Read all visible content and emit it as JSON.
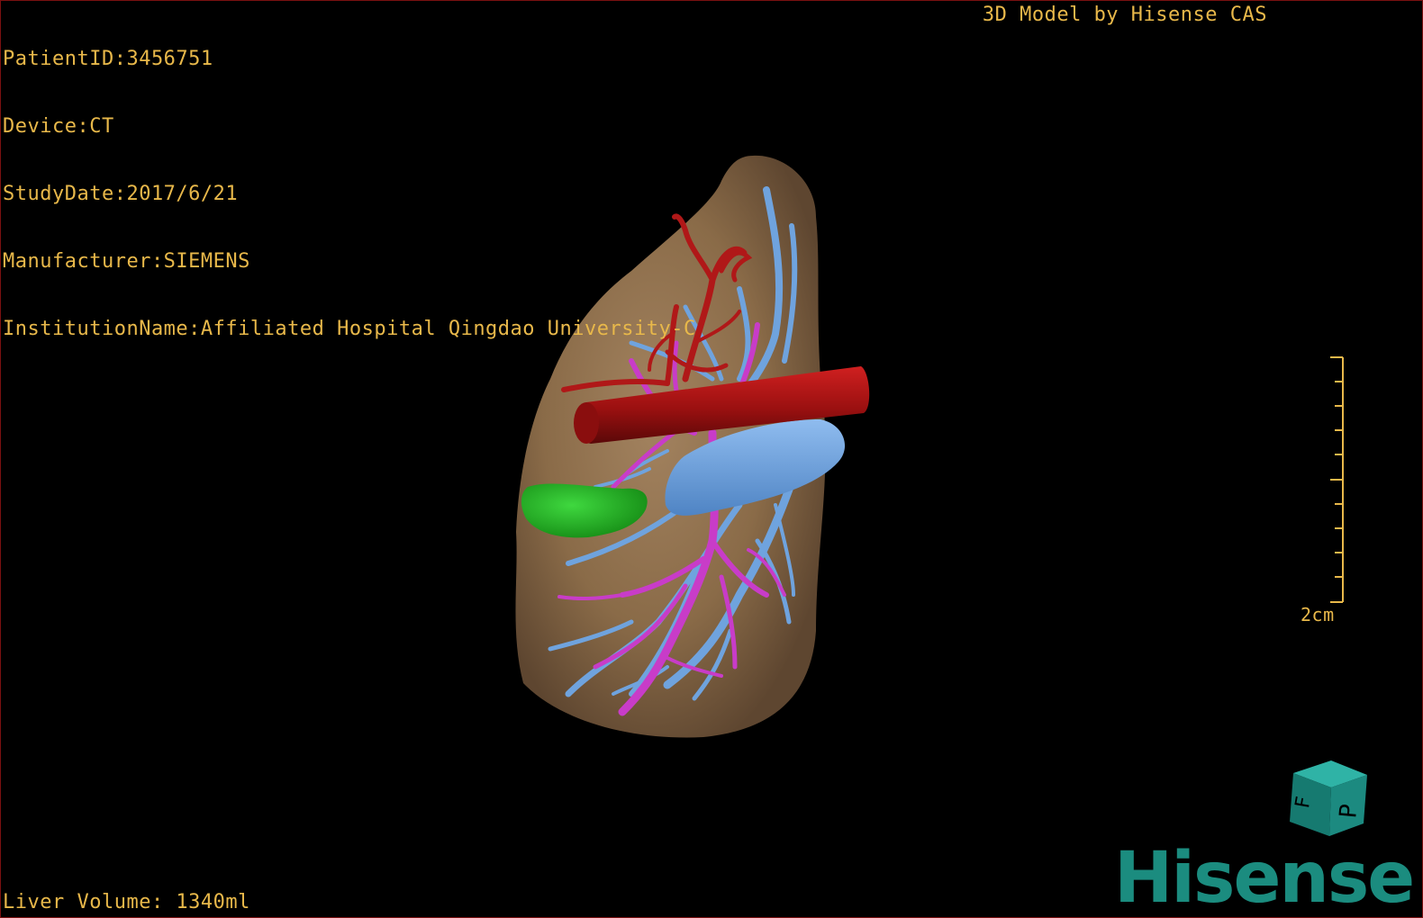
{
  "info": {
    "patient_id": "PatientID:3456751",
    "device": "Device:CT",
    "study_date": "StudyDate:2017/6/21",
    "manufacturer": "Manufacturer:SIEMENS",
    "institution": "InstitutionName:Affiliated Hospital Qingdao University-C"
  },
  "credit": "3D Model by Hisense CAS",
  "liver_volume": "Liver Volume: 1340ml",
  "scale_bar": {
    "label": "2cm"
  },
  "orientation_cube": {
    "face_letters": [
      "F",
      "P"
    ]
  },
  "logo": {
    "text": "Hisense"
  },
  "colors": {
    "overlay_text": "#e8b84a",
    "liver": "#8a6b48",
    "artery": "#b01818",
    "portal_vein": "#c83cc8",
    "hepatic_vein": "#6fa3de",
    "gallbladder": "#22b022",
    "logo": "#1b8c7f",
    "cube": "#1c8a80"
  },
  "icons": {
    "cube": "orientation-cube-icon"
  }
}
